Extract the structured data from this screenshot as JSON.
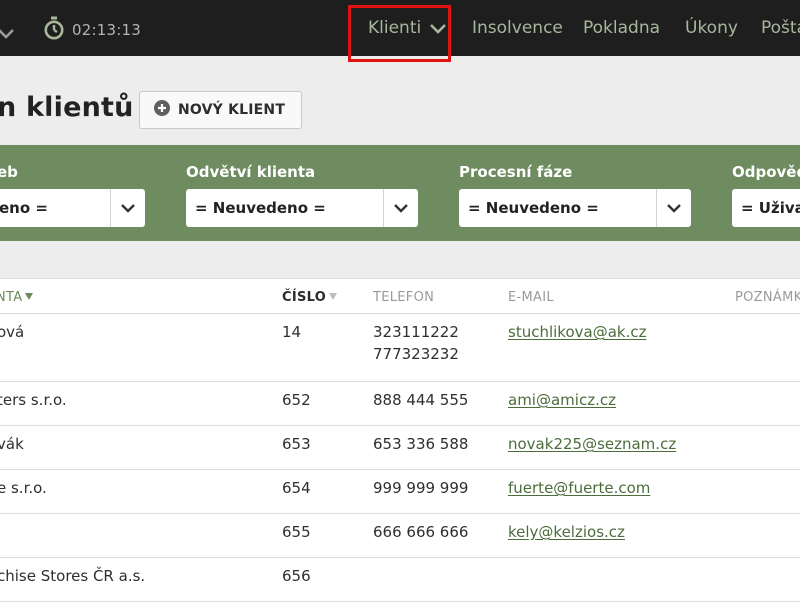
{
  "topbar": {
    "timer": "02:13:13",
    "nav": [
      {
        "label": "Klienti",
        "active": true
      },
      {
        "label": "Insolvence"
      },
      {
        "label": "Pokladna"
      },
      {
        "label": "Úkony"
      },
      {
        "label": "Pošta"
      }
    ]
  },
  "header": {
    "title": "n klientů",
    "new_client_label": "NOVÝ KLIENT"
  },
  "filters": [
    {
      "label": "eb",
      "value": "eno ="
    },
    {
      "label": "Odvětví klienta",
      "value": "= Neuvedeno ="
    },
    {
      "label": "Procesní fáze",
      "value": "= Neuvedeno ="
    },
    {
      "label": "Odpověd",
      "value": "= Uživa"
    }
  ],
  "table": {
    "columns": [
      "NTA",
      "ČÍSLO",
      "TELEFON",
      "E-MAIL",
      "POZNÁMK"
    ],
    "rows": [
      {
        "name": "ová",
        "cislo": "14",
        "telefon": [
          "323111222",
          "777323232"
        ],
        "email": "stuchlikova@ak.cz"
      },
      {
        "name": "ters s.r.o.",
        "cislo": "652",
        "telefon": [
          "888 444 555"
        ],
        "email": "ami@amicz.cz"
      },
      {
        "name": "vák",
        "cislo": "653",
        "telefon": [
          "653 336 588"
        ],
        "email": "novak225@seznam.cz"
      },
      {
        "name": "e s.r.o.",
        "cislo": "654",
        "telefon": [
          "999 999 999"
        ],
        "email": "fuerte@fuerte.com"
      },
      {
        "name": "",
        "cislo": "655",
        "telefon": [
          "666 666 666"
        ],
        "email": "kely@kelzios.cz"
      },
      {
        "name": "chise Stores ČR a.s.",
        "cislo": "656",
        "telefon": [],
        "email": ""
      }
    ]
  },
  "colors": {
    "topbar_bg": "#1e1e1e",
    "nav_text": "#a7b89a",
    "filter_band": "#6e8c60",
    "link": "#4b6d3b",
    "highlight": "#e01313"
  },
  "icons": [
    "chevron-down-icon",
    "stopwatch-icon",
    "plus-circle-icon",
    "sort-desc-icon"
  ]
}
